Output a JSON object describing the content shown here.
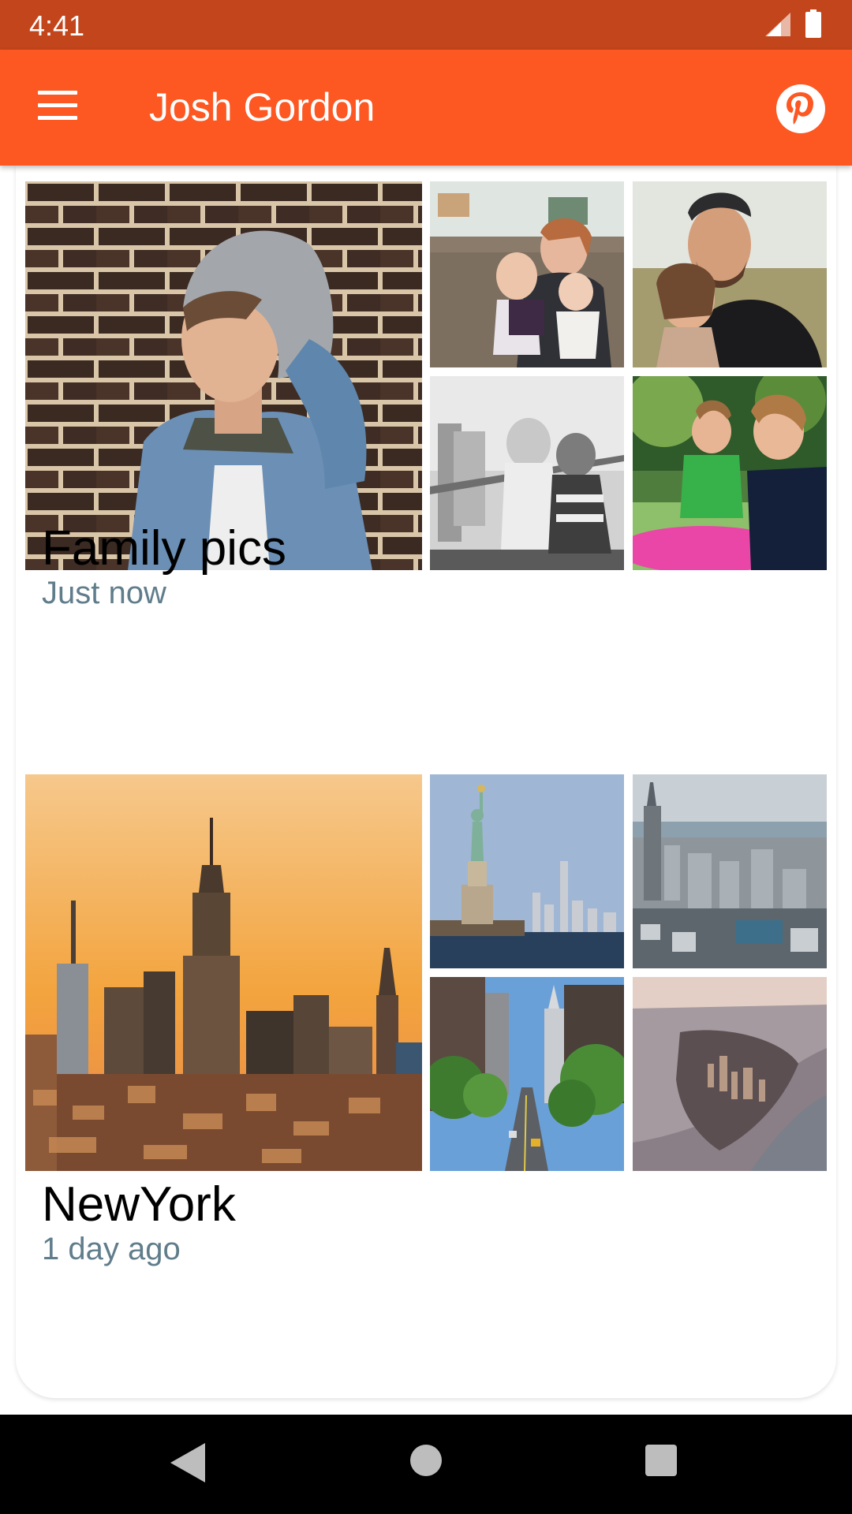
{
  "status_bar": {
    "time": "4:41"
  },
  "app_bar": {
    "title": "Josh Gordon",
    "menu_icon": "hamburger-menu-icon",
    "action_icon": "pinterest-icon"
  },
  "colors": {
    "status_bar": "#c2451c",
    "app_bar": "#fd5722",
    "subtitle": "#607d8b"
  },
  "albums": [
    {
      "title": "Family pics",
      "time": "Just now",
      "photos": [
        "Man in grey beanie and denim jacket against brick wall",
        "Mother with two children on a couch",
        "Bearded man hugging a little girl",
        "Two toddlers sitting by a railing (black and white)",
        "Two boys playing outdoors"
      ]
    },
    {
      "title": "NewYork",
      "time": "1 day ago",
      "photos": [
        "Manhattan skyline at sunset with Empire State Building",
        "Statue of Liberty with skyline",
        "Aerial view of Manhattan",
        "Tree-lined street with Chrysler Building",
        "Aerial view of lower Manhattan at dusk"
      ]
    }
  ],
  "nav_bar": {
    "back_icon": "back-triangle-icon",
    "home_icon": "home-circle-icon",
    "recents_icon": "recents-square-icon"
  }
}
